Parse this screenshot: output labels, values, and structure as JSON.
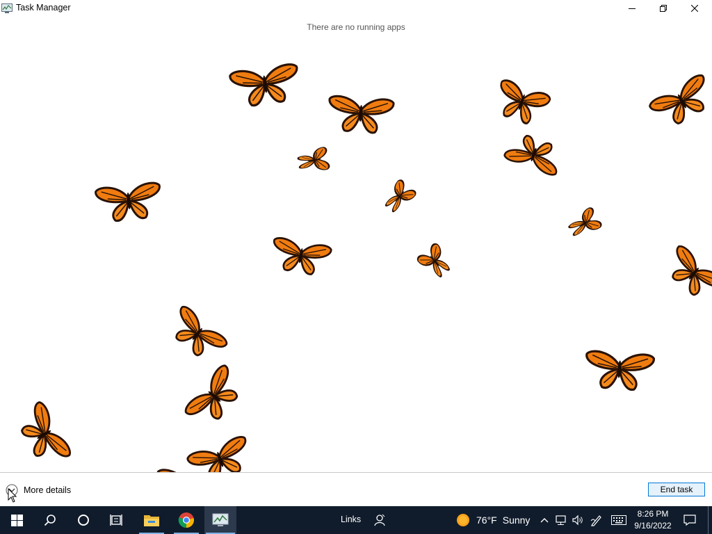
{
  "window": {
    "title": "Task Manager",
    "empty_message": "There are no running apps",
    "more_details_label": "More details",
    "end_task_label": "End task"
  },
  "taskbar": {
    "links_label": "Links",
    "weather_temp": "76°F",
    "weather_condition": "Sunny",
    "time": "8:26 PM",
    "date": "9/16/2022",
    "pinned": [
      "start-icon",
      "search-icon",
      "cortana-icon",
      "task-view-icon",
      "file-explorer-icon",
      "chrome-icon",
      "task-manager-icon"
    ],
    "tray": [
      "chevron-up-icon",
      "network-icon",
      "volume-icon",
      "pen-icon",
      "keyboard-icon",
      "notification-icon"
    ]
  },
  "colors": {
    "taskbar": "#101c2c",
    "butterfly_orange": "#f07c10",
    "butterfly_veins": "#2a1206",
    "accent": "#0078d7"
  }
}
